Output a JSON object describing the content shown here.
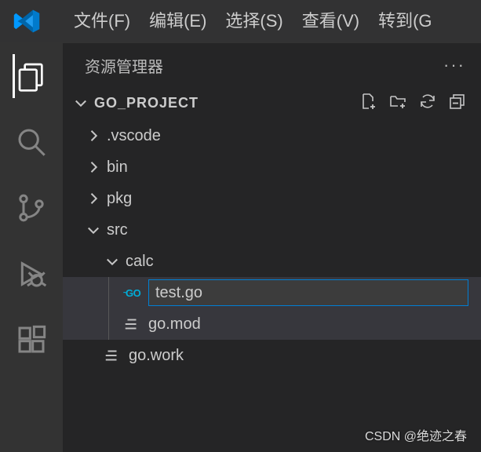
{
  "menu": {
    "file": "文件(F)",
    "edit": "编辑(E)",
    "select": "选择(S)",
    "view": "查看(V)",
    "go": "转到(G"
  },
  "sidebar": {
    "title": "资源管理器",
    "more": "···",
    "project": "GO_PROJECT"
  },
  "tree": {
    "vscode": ".vscode",
    "bin": "bin",
    "pkg": "pkg",
    "src": "src",
    "calc": "calc",
    "testgo": "test.go",
    "gomod": "go.mod",
    "gowork": "go.work"
  },
  "icons": {
    "go_label": "GO"
  },
  "watermark": "CSDN @绝迹之春"
}
